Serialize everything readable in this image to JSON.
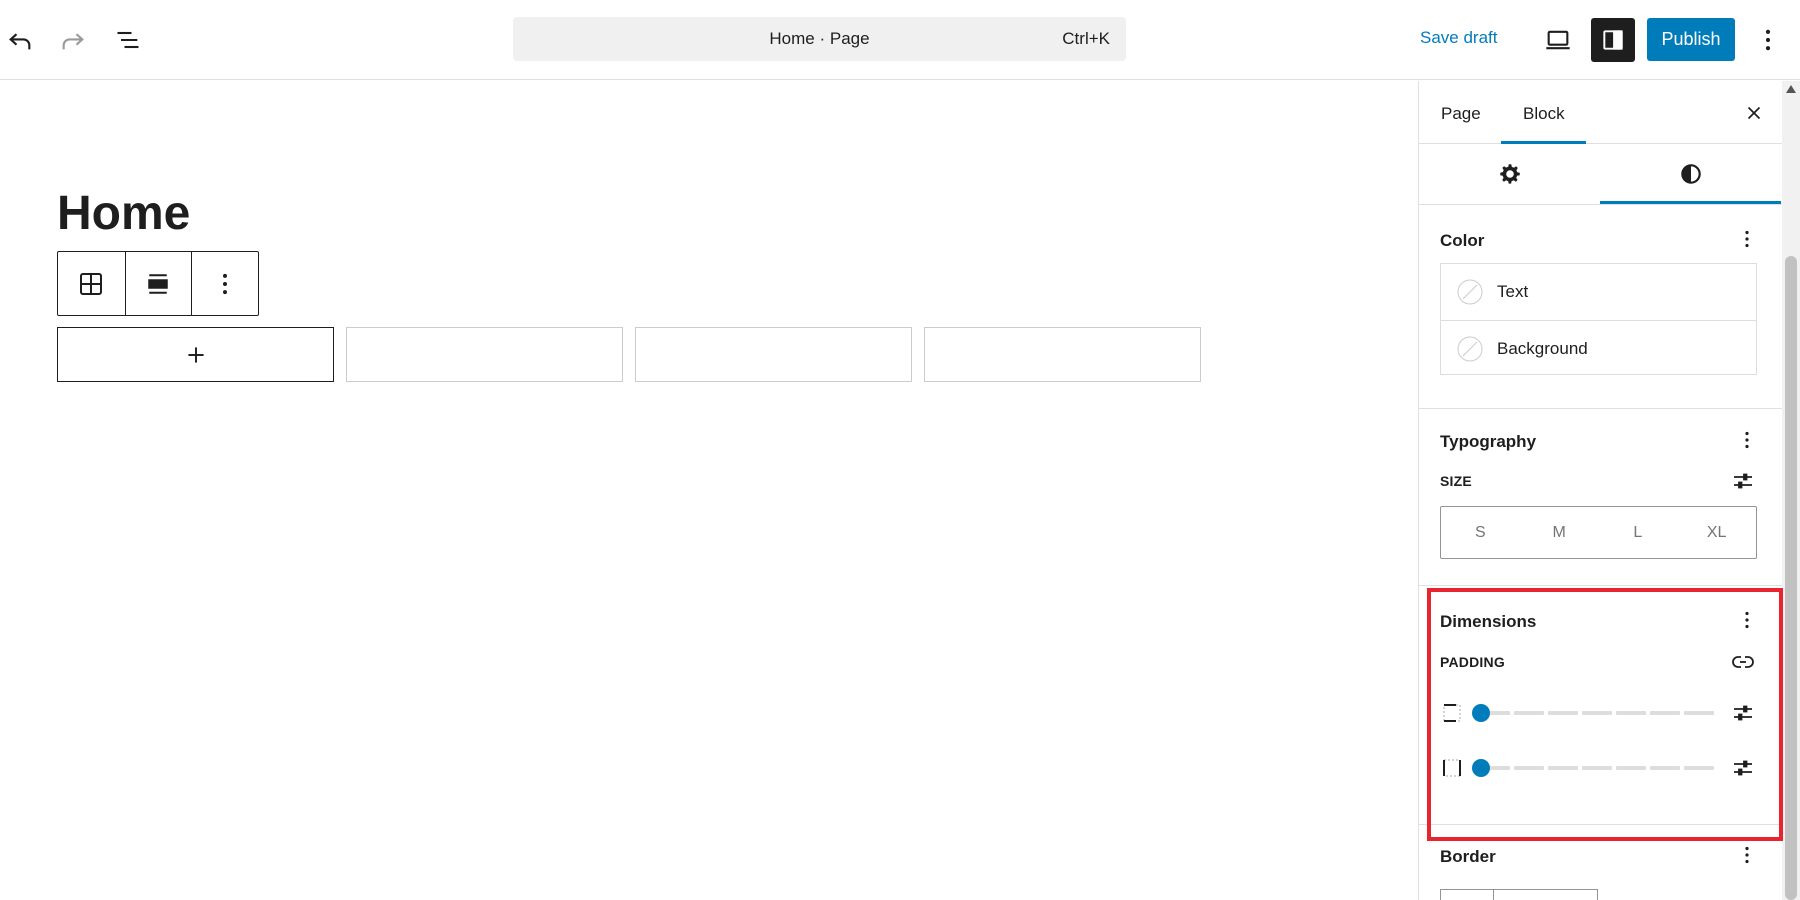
{
  "header": {
    "undo_icon": "undo-icon",
    "redo_icon": "redo-icon",
    "list_view_icon": "document-overview-icon",
    "command": {
      "title": "Home · Page",
      "shortcut": "Ctrl+K"
    },
    "save_draft": "Save draft",
    "device_icon": "desktop-preview-icon",
    "settings_icon": "sidebar-settings-icon",
    "publish": "Publish",
    "more_icon": "more-vertical-icon",
    "accent": "#007cba"
  },
  "canvas": {
    "title": "Home",
    "toolbar": [
      "table-icon",
      "align-icon",
      "more-vertical-icon"
    ],
    "add_icon": "plus-icon",
    "columns": 4
  },
  "sidebar": {
    "tabs": [
      "Page",
      "Block"
    ],
    "active_tab": "Block",
    "sub_tabs": [
      "settings-gear-icon",
      "styles-contrast-icon"
    ],
    "active_sub_tab": "styles-contrast-icon",
    "color": {
      "title": "Color",
      "items": [
        {
          "label": "Text"
        },
        {
          "label": "Background"
        }
      ]
    },
    "typography": {
      "title": "Typography",
      "size_label": "SIZE",
      "sizes": [
        "S",
        "M",
        "L",
        "XL"
      ]
    },
    "dimensions": {
      "title": "Dimensions",
      "padding_label": "PADDING",
      "rows": [
        {
          "side": "vertical",
          "value": 0
        },
        {
          "side": "horizontal",
          "value": 0
        }
      ]
    },
    "border": {
      "title": "Border"
    }
  },
  "highlight_color": "#e8252f"
}
